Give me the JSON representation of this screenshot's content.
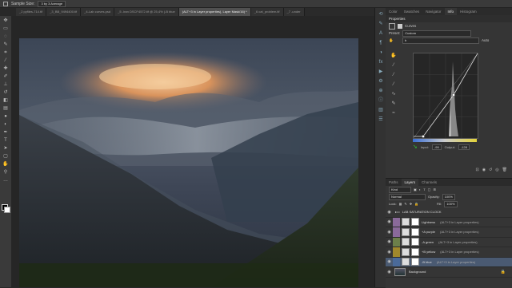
{
  "options_bar": {
    "sample_size_label": "Sample Size:",
    "sample_size_value": "3 by 3 Average"
  },
  "document_tabs": [
    {
      "label": "_2 pyfiles-714.tif",
      "active": false
    },
    {
      "label": "_3_BB_9494400.tif",
      "active": false
    },
    {
      "label": "_4-Lab curves.psd",
      "active": false
    },
    {
      "label": "_5 -Iran DSCF4572.tif @ 25,4% (-B blue",
      "active": false
    },
    {
      "label": "(ALT+3 in Layer properties), Layer Mask/16) *",
      "active": true
    },
    {
      "label": "_6 cat_problem.tif",
      "active": false
    },
    {
      "label": "_7 -under",
      "active": false
    }
  ],
  "panel_tabs": [
    {
      "label": "Color",
      "active": false
    },
    {
      "label": "Swatches",
      "active": false
    },
    {
      "label": "Navigator",
      "active": false
    },
    {
      "label": "Info",
      "active": true
    },
    {
      "label": "Histogram",
      "active": false
    }
  ],
  "properties": {
    "header": "Properties",
    "title": "Curves",
    "preset_label": "Preset:",
    "preset_value": "Custom",
    "channel_value": "b",
    "auto_label": "Auto",
    "input_label": "Input:",
    "input_value": "-99",
    "output_label": "Output:",
    "output_value": "-128"
  },
  "layers_panel": {
    "tabs": [
      {
        "label": "Paths",
        "active": false
      },
      {
        "label": "Layers",
        "active": true
      },
      {
        "label": "Channels",
        "active": false
      }
    ],
    "kind_label": "Kind",
    "blend_mode": "Normal",
    "opacity_label": "Opacity:",
    "opacity_value": "100%",
    "lock_label": "Lock:",
    "fill_label": "Fill:",
    "fill_value": "100%",
    "group_name": "LAB SATURATION CLOCK",
    "layers": [
      {
        "name": "Lightness",
        "note": "(ALT+3 in Layer properties)",
        "chip": "#8a6a9a",
        "selected": false
      },
      {
        "name": "+A purple",
        "note": "(ALT+3 in Layer properties)",
        "chip": "#8a6a9a",
        "selected": false
      },
      {
        "name": "-A green",
        "note": "(ALT+3 in Layer properties)",
        "chip": "#6c7f4a",
        "selected": false
      },
      {
        "name": "+B yellow",
        "note": "(ALT+3 in Layer properties)",
        "chip": "#a0882c",
        "selected": false
      },
      {
        "name": "-B blue",
        "note": "(ALT+3 in Layer properties)",
        "chip": "#4a6a9a",
        "selected": true
      }
    ],
    "background_name": "Background"
  }
}
